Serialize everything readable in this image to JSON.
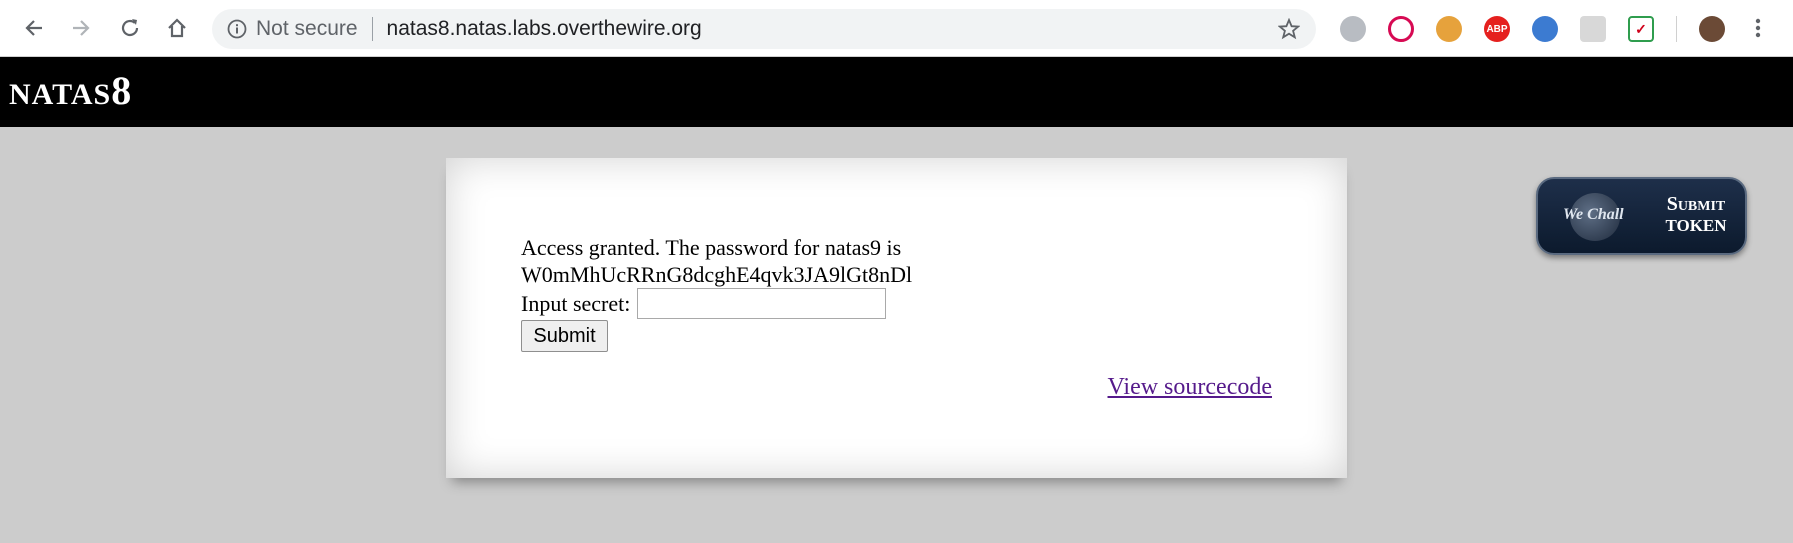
{
  "browser": {
    "security_label": "Not secure",
    "url": "natas8.natas.labs.overthewire.org",
    "icons": {
      "back": "back-arrow-icon",
      "forward": "forward-arrow-icon",
      "reload": "reload-icon",
      "home": "home-icon",
      "info": "info-icon",
      "bookmark": "star-icon"
    },
    "extensions": [
      {
        "name": "globe-extension-icon",
        "color": "#9aa0a6",
        "label": ""
      },
      {
        "name": "debian-extension-icon",
        "color": "#d70a53",
        "label": ""
      },
      {
        "name": "cookie-extension-icon",
        "color": "#e6a23c",
        "label": ""
      },
      {
        "name": "adblock-extension-icon",
        "color": "#e5201e",
        "label": "ABP"
      },
      {
        "name": "earth-extension-icon",
        "color": "#3c7bd1",
        "label": ""
      },
      {
        "name": "chat-extension-icon",
        "color": "#c7c7c7",
        "label": ""
      },
      {
        "name": "mcafee-extension-icon",
        "color": "#2f9d4e",
        "label": ""
      }
    ]
  },
  "header": {
    "title_prefix": "natas",
    "title_number": "8"
  },
  "content": {
    "message_line1": "Access granted. The password for natas9 is",
    "message_line2": "W0mMhUcRRnG8dcghE4qvk3JA9lGt8nDl",
    "input_label": "Input secret:",
    "input_value": "",
    "submit_label": "Submit",
    "source_link": "View sourcecode"
  },
  "token_button": {
    "logo_text": "We Chall",
    "line1": "Submit",
    "line2": "token"
  }
}
